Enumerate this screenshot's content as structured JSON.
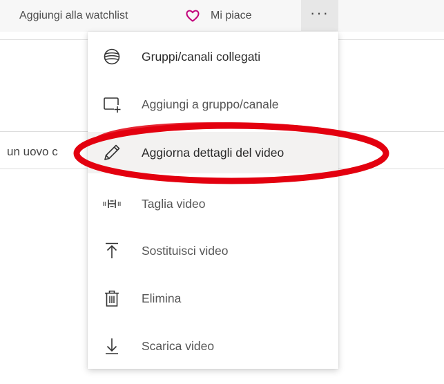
{
  "topbar": {
    "watchlist_label": "Aggiungi alla watchlist",
    "like_label": "Mi piace",
    "more_label": "···",
    "heart_color": "#c2007a"
  },
  "background": {
    "partial_text": "un uovo c"
  },
  "menu": {
    "items": [
      {
        "label": "Gruppi/canali collegati",
        "icon": "globe-icon"
      },
      {
        "label": "Aggiungi a gruppo/canale",
        "icon": "add-to-group-icon"
      },
      {
        "label": "Aggiorna dettagli del video",
        "icon": "pencil-icon",
        "highlighted": true
      },
      {
        "label": "Taglia video",
        "icon": "trim-icon"
      },
      {
        "label": "Sostituisci video",
        "icon": "upload-icon"
      },
      {
        "label": "Elimina",
        "icon": "trash-icon"
      },
      {
        "label": "Scarica video",
        "icon": "download-icon"
      }
    ]
  },
  "annotation": {
    "color": "#e3000f"
  }
}
